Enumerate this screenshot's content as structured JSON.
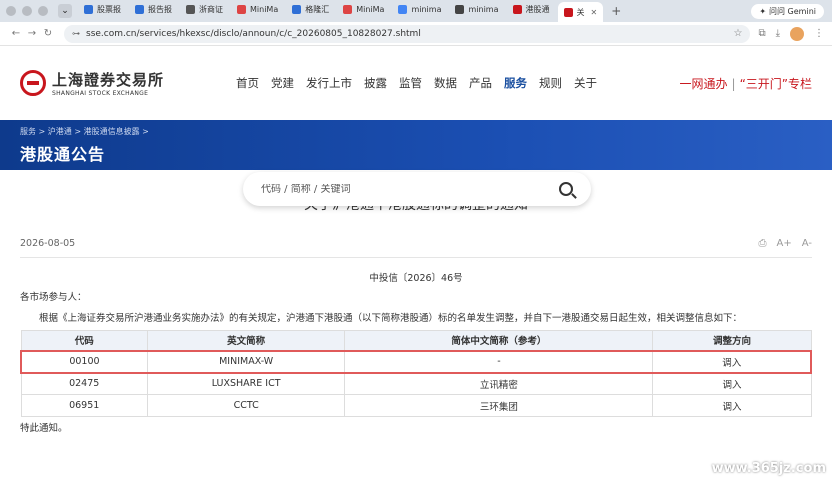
{
  "browser": {
    "tabs": [
      {
        "label": "股票报",
        "color": "#2f6fd6"
      },
      {
        "label": "报告报",
        "color": "#2f6fd6"
      },
      {
        "label": "浙商证",
        "color": "#555555"
      },
      {
        "label": "MiniMa",
        "color": "#d44"
      },
      {
        "label": "格隆汇",
        "color": "#2f6fd6"
      },
      {
        "label": "MiniMa",
        "color": "#d44"
      },
      {
        "label": "minima",
        "color": "#4285f4"
      },
      {
        "label": "minima",
        "color": "#444"
      },
      {
        "label": "港股通",
        "color": "#c8161d"
      },
      {
        "label": "关",
        "color": "#c8161d"
      }
    ],
    "gemini": "问问 Gemini",
    "url": "sse.com.cn/services/hkexsc/disclo/announ/c/c_20260805_10828027.shtml"
  },
  "header": {
    "logo_cn": "上海證券交易所",
    "logo_en": "SHANGHAI STOCK EXCHANGE",
    "nav": [
      "首页",
      "党建",
      "发行上市",
      "披露",
      "监管",
      "数据",
      "产品",
      "服务",
      "规则",
      "关于"
    ],
    "active_nav": "服务",
    "special_left": "一网通办",
    "special_right": "“三开门”专栏"
  },
  "banner": {
    "crumbs": "服务  >  沪港通  >  港股通信息披露  >",
    "title": "港股通公告"
  },
  "search": {
    "placeholder": "代码 / 简称 / 关键词"
  },
  "article": {
    "title": "关于沪港通下港股通标的调整的通知",
    "date": "2026-08-05",
    "doc_no": "中投信〔2026〕46号",
    "salutation": "各市场参与人：",
    "body": "根据《上海证券交易所沪港通业务实施办法》的有关规定，沪港通下港股通（以下简称港股通）标的名单发生调整，并自下一港股通交易日起生效，相关调整信息如下：",
    "table": {
      "headers": [
        "代码",
        "英文简称",
        "简体中文简称（参考）",
        "调整方向"
      ],
      "rows": [
        [
          "00100",
          "MINIMAX-W",
          "-",
          "调入"
        ],
        [
          "02475",
          "LUXSHARE ICT",
          "立讯精密",
          "调入"
        ],
        [
          "06951",
          "CCTC",
          "三环集团",
          "调入"
        ]
      ]
    },
    "closing": "特此通知。"
  },
  "watermark": "www.365jz.com"
}
